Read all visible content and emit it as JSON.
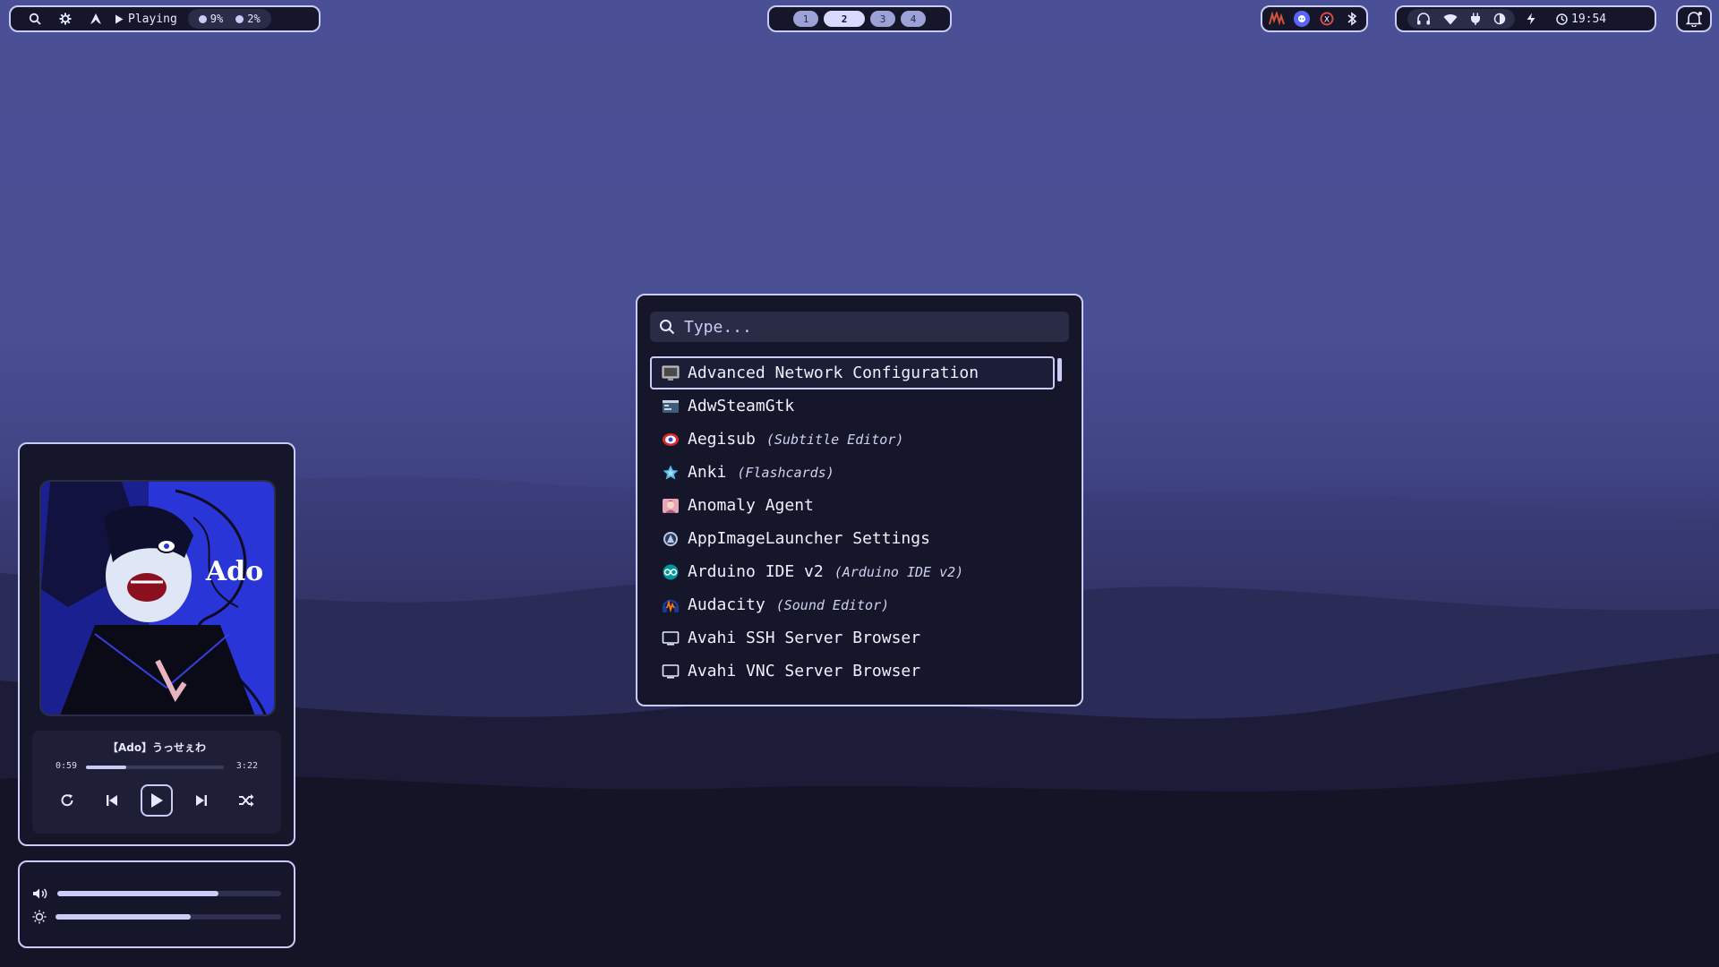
{
  "topbar": {
    "left": {
      "search_icon": "search-icon",
      "settings_icon": "gear-icon",
      "arch_icon": "arch-logo-icon",
      "playing_label": "Playing",
      "cpu_label": "9%",
      "mem_label": "2%"
    },
    "workspaces": [
      "1",
      "2",
      "3",
      "4"
    ],
    "active_workspace": "2",
    "clock": "19:54"
  },
  "launcher": {
    "search_placeholder": "Type...",
    "items": [
      {
        "name": "Advanced Network Configuration",
        "desc": "",
        "icon": "network-icon"
      },
      {
        "name": "AdwSteamGtk",
        "desc": "",
        "icon": "steam-gtk-icon"
      },
      {
        "name": "Aegisub",
        "desc": "(Subtitle Editor)",
        "icon": "aegisub-icon"
      },
      {
        "name": "Anki",
        "desc": "(Flashcards)",
        "icon": "anki-icon"
      },
      {
        "name": "Anomaly Agent",
        "desc": "",
        "icon": "anomaly-agent-icon"
      },
      {
        "name": "AppImageLauncher Settings",
        "desc": "",
        "icon": "appimage-icon"
      },
      {
        "name": "Arduino IDE v2",
        "desc": "(Arduino IDE v2)",
        "icon": "arduino-icon"
      },
      {
        "name": "Audacity",
        "desc": "(Sound Editor)",
        "icon": "audacity-icon"
      },
      {
        "name": "Avahi SSH Server Browser",
        "desc": "",
        "icon": "monitor-icon"
      },
      {
        "name": "Avahi VNC Server Browser",
        "desc": "",
        "icon": "monitor-icon"
      }
    ]
  },
  "media": {
    "cover_text": "Ado",
    "title": "【Ado】うっせぇわ",
    "elapsed": "0:59",
    "duration": "3:22",
    "progress": 0.29
  },
  "controls": {
    "volume": 0.72,
    "brightness": 0.6
  },
  "colors": {
    "accent": "#c9ccf6",
    "panel_bg": "#15162a",
    "wallpaper_top": "#4b4f95"
  }
}
